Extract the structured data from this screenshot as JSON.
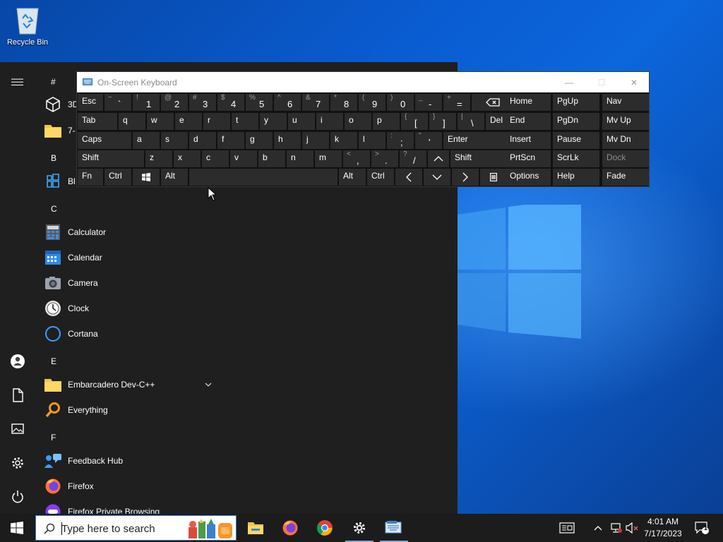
{
  "desktop": {
    "icons": [
      {
        "label": "Recycle Bin",
        "icon": "recycle-bin-icon"
      }
    ]
  },
  "start_menu": {
    "rail": [
      "hamburger-menu-icon",
      "user-icon",
      "documents-icon",
      "pictures-icon",
      "settings-gear-icon",
      "power-icon"
    ],
    "letters": {
      "hash": "#",
      "b": "B",
      "c": "C",
      "e": "E",
      "f": "F"
    },
    "apps": {
      "app_3d": "3D",
      "app_7zip": "7-",
      "app_bl": "Bl",
      "calculator": "Calculator",
      "calendar": "Calendar",
      "camera": "Camera",
      "clock": "Clock",
      "cortana": "Cortana",
      "embarcadero": "Embarcadero Dev-C++",
      "everything": "Everything",
      "feedback_hub": "Feedback Hub",
      "firefox": "Firefox",
      "firefox_private": "Firefox Private Browsing"
    }
  },
  "osk": {
    "title": "On-Screen Keyboard",
    "controls": {
      "minimize": "—",
      "maximize": "☐",
      "close": "✕"
    },
    "row1": [
      {
        "m": "Esc"
      },
      {
        "s": "~",
        "p": "`"
      },
      {
        "s": "!",
        "p": "1"
      },
      {
        "s": "@",
        "p": "2"
      },
      {
        "s": "#",
        "p": "3"
      },
      {
        "s": "$",
        "p": "4"
      },
      {
        "s": "%",
        "p": "5"
      },
      {
        "s": "^",
        "p": "6"
      },
      {
        "s": "&",
        "p": "7"
      },
      {
        "s": "*",
        "p": "8"
      },
      {
        "s": "(",
        "p": "9"
      },
      {
        "s": ")",
        "p": "0"
      },
      {
        "s": "_",
        "p": "-"
      },
      {
        "s": "+",
        "p": "="
      }
    ],
    "row2": [
      {
        "m": "Tab"
      },
      {
        "m": "q"
      },
      {
        "m": "w"
      },
      {
        "m": "e"
      },
      {
        "m": "r"
      },
      {
        "m": "t"
      },
      {
        "m": "y"
      },
      {
        "m": "u"
      },
      {
        "m": "i"
      },
      {
        "m": "o"
      },
      {
        "m": "p"
      },
      {
        "s": "{",
        "p": "["
      },
      {
        "s": "}",
        "p": "]"
      },
      {
        "s": "|",
        "p": "\\"
      },
      {
        "m": "Del"
      }
    ],
    "row3": [
      {
        "m": "Caps"
      },
      {
        "m": "a"
      },
      {
        "m": "s"
      },
      {
        "m": "d"
      },
      {
        "m": "f"
      },
      {
        "m": "g"
      },
      {
        "m": "h"
      },
      {
        "m": "j"
      },
      {
        "m": "k"
      },
      {
        "m": "l"
      },
      {
        "s": ":",
        "p": ";"
      },
      {
        "s": "\"",
        "p": "'"
      },
      {
        "m": "Enter"
      }
    ],
    "row4": [
      {
        "m": "Shift"
      },
      {
        "m": "z"
      },
      {
        "m": "x"
      },
      {
        "m": "c"
      },
      {
        "m": "v"
      },
      {
        "m": "b"
      },
      {
        "m": "n"
      },
      {
        "m": "m"
      },
      {
        "s": "<",
        "p": ","
      },
      {
        "s": ">",
        "p": "."
      },
      {
        "s": "?",
        "p": "/"
      },
      {
        "m": ""
      },
      {
        "m": "Shift"
      }
    ],
    "row5": [
      {
        "m": "Fn"
      },
      {
        "m": "Ctrl"
      },
      {
        "m": ""
      },
      {
        "m": "Alt"
      },
      {
        "m": ""
      },
      {
        "m": "Alt"
      },
      {
        "m": "Ctrl"
      },
      {
        "m": ""
      },
      {
        "m": ""
      },
      {
        "m": ""
      },
      {
        "m": ""
      }
    ],
    "nav_keys": [
      [
        "Home",
        "PgUp",
        "Nav"
      ],
      [
        "End",
        "PgDn",
        "Mv Up"
      ],
      [
        "Insert",
        "Pause",
        "Mv Dn"
      ],
      [
        "PrtScn",
        "ScrLk",
        "Dock"
      ],
      [
        "Options",
        "Help",
        "Fade"
      ]
    ]
  },
  "taskbar": {
    "search_placeholder": "Type here to search",
    "pinned": [
      "file-explorer-icon",
      "firefox-icon",
      "chrome-icon",
      "settings-icon",
      "osk-app-icon"
    ],
    "tray": [
      "news-widget-icon",
      "chevron-up-icon",
      "network-icon",
      "volume-muted-icon",
      "notification-icon"
    ],
    "notification_count": "1",
    "time": "4:01 AM",
    "date": "7/17/2023"
  }
}
